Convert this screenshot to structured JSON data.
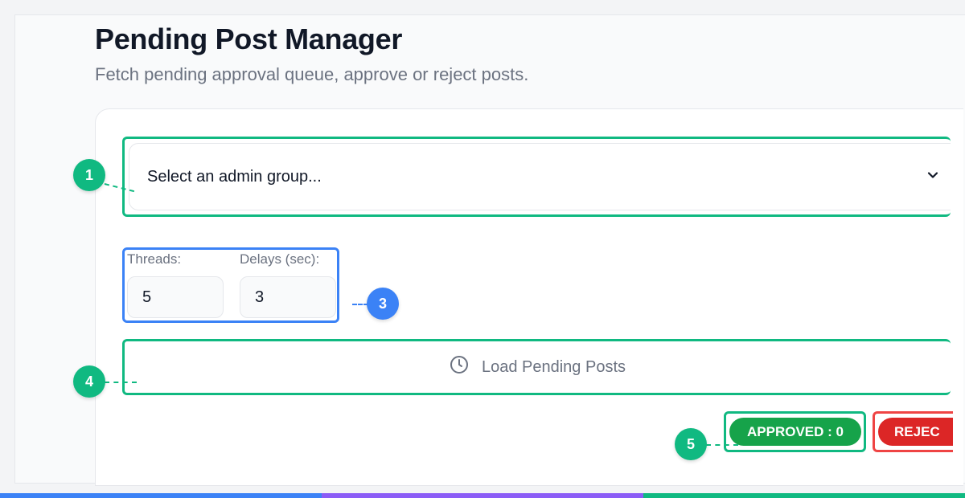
{
  "header": {
    "title": "Pending Post Manager",
    "subtitle": "Fetch pending approval queue, approve or reject posts."
  },
  "group_select": {
    "placeholder": "Select an admin group...",
    "icon": "chevron-down-icon"
  },
  "settings": {
    "threads_label": "Threads:",
    "threads_value": "5",
    "delays_label": "Delays (sec):",
    "delays_value": "3"
  },
  "load_button": {
    "label": "Load Pending Posts",
    "icon": "clock-icon"
  },
  "counters": {
    "approved_label": "APPROVED : 0",
    "rejected_label": "REJEC"
  },
  "callouts": {
    "c1": "1",
    "c3": "3",
    "c4": "4",
    "c5": "5"
  },
  "colors": {
    "callout_green": "#10b981",
    "callout_blue": "#3b82f6",
    "approved": "#16a34a",
    "rejected": "#dc2626",
    "bar": [
      "#3b82f6",
      "#8b5cf6",
      "#10b981"
    ]
  }
}
